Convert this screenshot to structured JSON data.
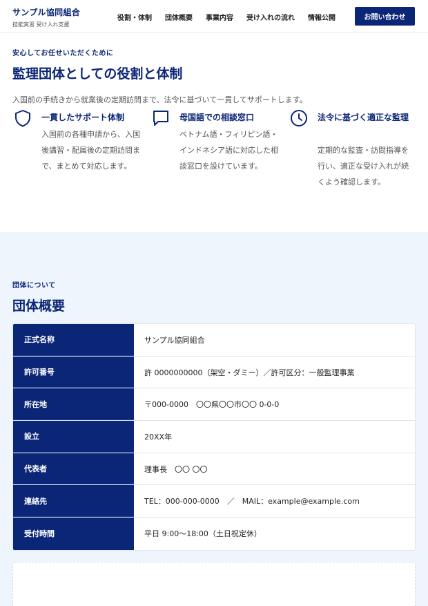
{
  "header": {
    "brand_name": "サンプル協同組合",
    "brand_sub": "技能実習 受け入れ支援",
    "nav": [
      "役割・体制",
      "団体概要",
      "事業内容",
      "受け入れの流れ",
      "情報公開"
    ],
    "cta": "お問い合わせ"
  },
  "role_section": {
    "eyebrow": "安心してお任せいただくために",
    "title": "監理団体としての役割と体制",
    "lead": "入国前の手続きから就業後の定期訪問まで、法令に基づいて一貫してサポートします。",
    "features": [
      {
        "icon": "shield-icon",
        "title": "一貫したサポート体制",
        "body": "入国前の各種申請から、入国後講習・配属後の定期訪問まで、まとめて対応します。"
      },
      {
        "icon": "chat-bubble-icon",
        "title": "母国語での相談窓口",
        "body": "ベトナム語・フィリピン語・インドネシア語に対応した相談窓口を設けています。"
      },
      {
        "icon": "clock-icon",
        "title": "法令に基づく適正な監理",
        "body": "定期的な監査・訪問指導を行い、適正な受け入れが続くよう確認します。"
      }
    ]
  },
  "org_section": {
    "eyebrow": "団体について",
    "title": "団体概要",
    "rows": [
      {
        "label": "正式名称",
        "value": "サンプル協同組合"
      },
      {
        "label": "許可番号",
        "value": "許 0000000000（架空・ダミー）／許可区分：一般監理事業"
      },
      {
        "label": "所在地",
        "value": "〒000-0000　〇〇県〇〇市〇〇 0-0-0"
      },
      {
        "label": "設立",
        "value": "20XX年"
      },
      {
        "label": "代表者",
        "value": "理事長　〇〇 〇〇"
      },
      {
        "label": "連絡先",
        "value": "TEL：000-000-0000　／　MAIL：example@example.com"
      },
      {
        "label": "受付時間",
        "value": "平日 9:00〜18:00（土日祝定休）"
      }
    ]
  },
  "colors": {
    "primary": "#0b2577",
    "section_bg": "#eef5fd",
    "border": "#dfe5ec"
  }
}
